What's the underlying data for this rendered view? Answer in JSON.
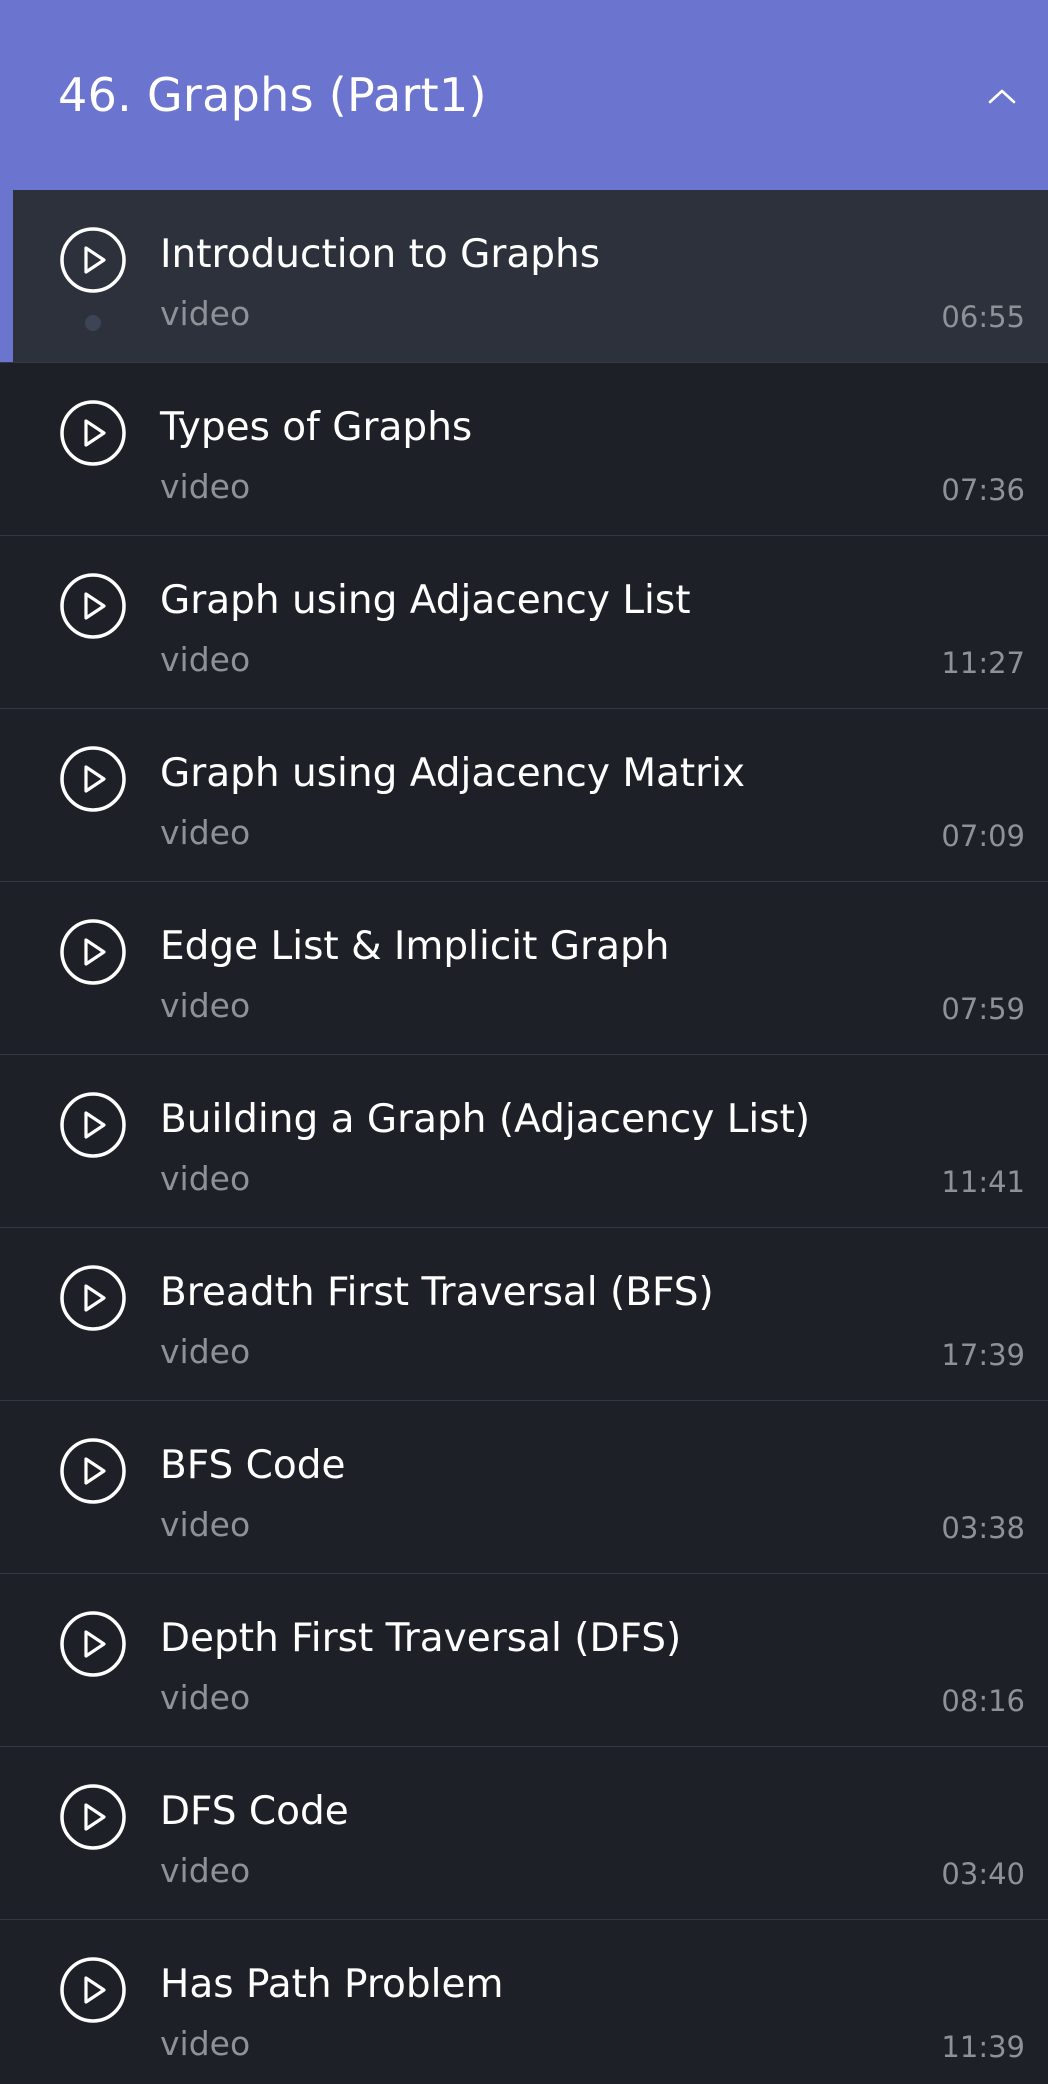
{
  "section": {
    "title": "46. Graphs (Part1)",
    "expanded": true,
    "toggle_icon": "chevron-up-icon",
    "accent_color": "#6b74cf"
  },
  "lessons": [
    {
      "title": "Introduction to Graphs",
      "type": "video",
      "duration": "06:55",
      "active": true
    },
    {
      "title": "Types of Graphs",
      "type": "video",
      "duration": "07:36",
      "active": false
    },
    {
      "title": "Graph using Adjacency List",
      "type": "video",
      "duration": "11:27",
      "active": false
    },
    {
      "title": "Graph using Adjacency Matrix",
      "type": "video",
      "duration": "07:09",
      "active": false
    },
    {
      "title": "Edge List & Implicit Graph",
      "type": "video",
      "duration": "07:59",
      "active": false
    },
    {
      "title": "Building a Graph (Adjacency List)",
      "type": "video",
      "duration": "11:41",
      "active": false
    },
    {
      "title": "Breadth First Traversal (BFS)",
      "type": "video",
      "duration": "17:39",
      "active": false
    },
    {
      "title": "BFS Code",
      "type": "video",
      "duration": "03:38",
      "active": false
    },
    {
      "title": "Depth First Traversal (DFS)",
      "type": "video",
      "duration": "08:16",
      "active": false
    },
    {
      "title": "DFS Code",
      "type": "video",
      "duration": "03:40",
      "active": false
    },
    {
      "title": "Has Path Problem",
      "type": "video",
      "duration": "11:39",
      "active": false
    }
  ],
  "icons": {
    "lesson_icon": "play-circle-icon"
  }
}
